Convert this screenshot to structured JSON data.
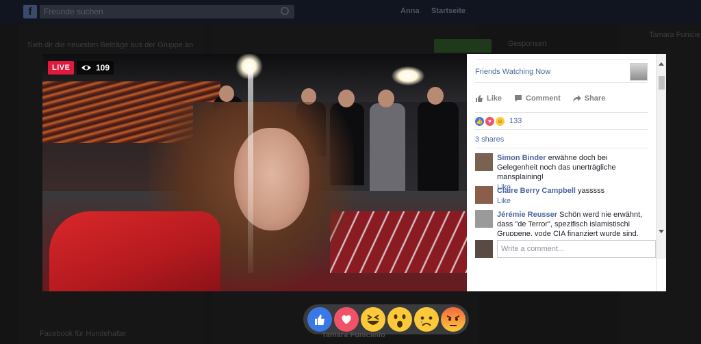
{
  "topbar": {
    "logo": "f",
    "search_placeholder": "Freunde suchen",
    "nav_items": [
      "Anna",
      "Startseite"
    ]
  },
  "background": {
    "banner_text": "Sieh dir die neuesten Beiträge aus der Gruppe an",
    "sponsored": "Gesponsert",
    "sidebar_name": "Tamara Funiciello",
    "bottom_text": "Facebook für Hundehalter"
  },
  "video": {
    "live_label": "LIVE",
    "viewer_count": "109"
  },
  "sidebar": {
    "friends_title": "Friends Watching Now",
    "actions": {
      "like": "Like",
      "comment": "Comment",
      "share": "Share"
    },
    "reaction_count": "133",
    "shares_text": "3 shares",
    "comments": [
      {
        "name": "Simon Binder",
        "text": "erwähne doch bei Gelegenheit noch das unerträgliche mansplaining!",
        "like": "Like"
      },
      {
        "name": "Claire Berry Campbell",
        "text": "yasssss",
        "like": "Like"
      },
      {
        "name": "Jérémie Reusser",
        "text": "Schön werd nie erwähnt, dass \"de Terror\", spezifisch islamistischi Gruppene, vode CIA finanziert wurde sind, wo",
        "like": ""
      }
    ],
    "comment_placeholder": "Write a comment..."
  },
  "reaction_bar": {
    "items": [
      "like-icon",
      "love-icon",
      "haha-icon",
      "wow-icon",
      "sad-icon",
      "angry-icon"
    ]
  },
  "streamer_name": "Tamara Funiciello",
  "colors": {
    "live": "#e0193d",
    "link": "#4b67a1",
    "like": "#3b78e7",
    "love": "#f25268",
    "emoji": "#fcc93a"
  }
}
